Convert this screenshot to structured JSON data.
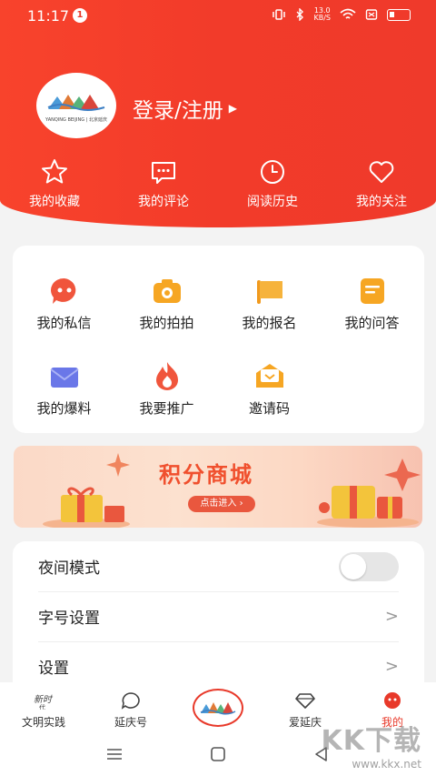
{
  "status_bar": {
    "time": "11:17",
    "notification_count": "1",
    "net_speed_value": "13.0",
    "net_speed_unit": "KB/S"
  },
  "header": {
    "login_label": "登录/注册",
    "avatar_logo_text": "YANQING BEIJING | 北京延庆",
    "quick_links": [
      {
        "label": "我的收藏",
        "icon": "star-icon"
      },
      {
        "label": "我的评论",
        "icon": "comment-icon"
      },
      {
        "label": "阅读历史",
        "icon": "clock-icon"
      },
      {
        "label": "我的关注",
        "icon": "heart-icon"
      }
    ]
  },
  "functions": [
    {
      "label": "我的私信",
      "icon": "message-icon",
      "color": "#f0553c"
    },
    {
      "label": "我的拍拍",
      "icon": "camera-icon",
      "color": "#f6a623"
    },
    {
      "label": "我的报名",
      "icon": "flag-icon",
      "color": "#f6a623"
    },
    {
      "label": "我的问答",
      "icon": "note-icon",
      "color": "#f6a623"
    },
    {
      "label": "我的爆料",
      "icon": "envelope-icon",
      "color": "#6a77e8"
    },
    {
      "label": "我要推广",
      "icon": "fire-icon",
      "color": "#f0553c"
    },
    {
      "label": "邀请码",
      "icon": "invite-icon",
      "color": "#f6a623"
    }
  ],
  "mall_banner": {
    "title": "积分商城",
    "button_label": "点击进入 ›"
  },
  "settings": [
    {
      "label": "夜间模式",
      "type": "toggle",
      "on": false
    },
    {
      "label": "字号设置",
      "type": "link"
    },
    {
      "label": "设置",
      "type": "link"
    }
  ],
  "tabbar": {
    "tabs": [
      {
        "label": "文明实践",
        "icon": "civilization-icon",
        "active": false
      },
      {
        "label": "延庆号",
        "icon": "speech-bubble-icon",
        "active": false
      },
      {
        "label": "爱延庆",
        "icon": "diamond-icon",
        "active": false
      },
      {
        "label": "我的",
        "icon": "profile-face-icon",
        "active": true
      }
    ],
    "center_logo": "yanqing-logo-icon",
    "active_color": "#e8392a"
  },
  "watermark": {
    "text": "KK下载",
    "url": "www.kkx.net"
  },
  "colors": {
    "brand_red": "#f23b2a",
    "page_bg": "#f3f3f3"
  }
}
